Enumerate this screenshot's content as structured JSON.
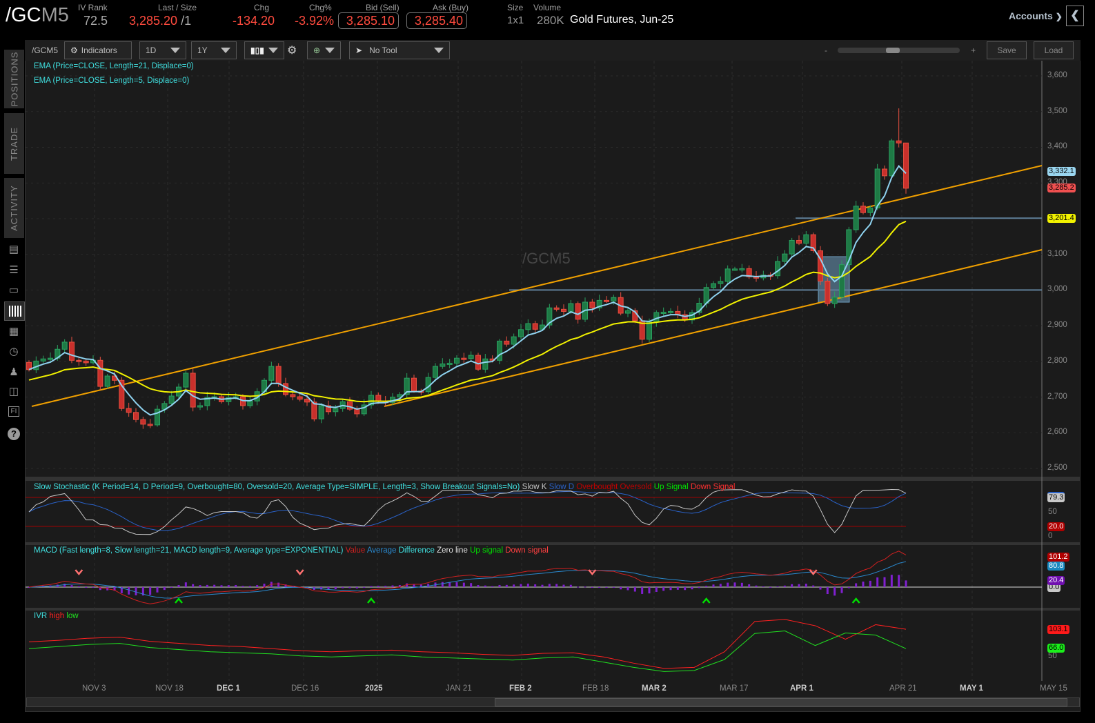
{
  "header": {
    "symbol_root": "/GC",
    "symbol_month": "M5",
    "iv_rank_label": "IV Rank",
    "iv_rank": "72.5",
    "last_label": "Last / Size",
    "last": "3,285.20",
    "size": "/1",
    "chg_label": "Chg",
    "chg": "-134.20",
    "chg_pct_label": "Chg%",
    "chg_pct": "-3.92%",
    "bid_label": "Bid (Sell)",
    "bid": "3,285.10",
    "ask_label": "Ask (Buy)",
    "ask": "3,285.40",
    "size_label": "Size",
    "size_value": "1x1",
    "volume_label": "Volume",
    "volume": "280K",
    "description": "Gold Futures, Jun-25",
    "accounts": "Accounts"
  },
  "sidebar": {
    "tabs": [
      "POSITIONS",
      "TRADE",
      "ACTIVITY"
    ],
    "icons": [
      "chart-report-icon",
      "list-icon",
      "tv-icon",
      "chart-icon",
      "grid-icon",
      "clock-icon",
      "people-icon",
      "calendar-icon",
      "fi-icon",
      "help-icon"
    ],
    "fi_label": "FI",
    "help_label": "?"
  },
  "toolbar": {
    "symbol": "/GCM5",
    "indicators": "Indicators",
    "aggregation": "1D",
    "range": "1Y",
    "drawing_tool": "No Tool",
    "zoom_minus": "-",
    "zoom_plus": "+",
    "save": "Save",
    "load": "Load"
  },
  "main_chart": {
    "watermark": "/GCM5",
    "studies": [
      "EMA (Price=CLOSE, Length=21, Displace=0)",
      "EMA (Price=CLOSE, Length=5, Displace=0)"
    ],
    "price_ticks": [
      "3,600",
      "3,500",
      "3,400",
      "3,300",
      "3,100",
      "3,000",
      "2,900",
      "2,800",
      "2,700",
      "2,600",
      "2,500"
    ],
    "tags": {
      "ema5": "3,332.1",
      "last": "3,285.2",
      "ema21": "3,201.4"
    },
    "colors": {
      "up": "#1e7a45",
      "down": "#c9302c",
      "ema5": "#8fd3f0",
      "ema21": "#f2f200",
      "trendline": "#f0a000",
      "level": "#5f7f99"
    }
  },
  "chart_data": {
    "type": "candlestick",
    "x_tick_labels": [
      "NOV 3",
      "NOV 18",
      "DEC 1",
      "DEC 16",
      "2025",
      "JAN 21",
      "FEB 2",
      "FEB 18",
      "MAR 2",
      "MAR 17",
      "APR 1",
      "APR 21",
      "MAY 1",
      "MAY 15"
    ],
    "ylim": [
      2500,
      3600
    ],
    "closes": [
      2777,
      2801,
      2807,
      2809,
      2834,
      2854,
      2803,
      2801,
      2796,
      2803,
      2730,
      2759,
      2747,
      2668,
      2657,
      2637,
      2624,
      2622,
      2666,
      2682,
      2703,
      2728,
      2767,
      2672,
      2676,
      2699,
      2701,
      2687,
      2699,
      2701,
      2676,
      2689,
      2715,
      2747,
      2786,
      2738,
      2707,
      2701,
      2694,
      2686,
      2639,
      2676,
      2659,
      2668,
      2687,
      2666,
      2653,
      2678,
      2705,
      2688,
      2685,
      2700,
      2707,
      2753,
      2717,
      2715,
      2755,
      2786,
      2793,
      2795,
      2809,
      2808,
      2817,
      2778,
      2807,
      2803,
      2857,
      2848,
      2869,
      2889,
      2906,
      2890,
      2902,
      2950,
      2946,
      2940,
      2962,
      2918,
      2966,
      2950,
      2971,
      2969,
      2979,
      2935,
      2942,
      2914,
      2862,
      2910,
      2937,
      2938,
      2940,
      2931,
      2916,
      2937,
      2963,
      3007,
      3018,
      3024,
      3059,
      3059,
      3060,
      3037,
      3034,
      3042,
      3040,
      3080,
      3101,
      3139,
      3131,
      3155,
      3110,
      3025,
      2962,
      2980,
      3071,
      3169,
      3235,
      3217,
      3230,
      3339,
      3320,
      3418,
      3412,
      3285.2
    ],
    "levels": [
      3000,
      3201.4
    ]
  },
  "stochastic": {
    "legend": "Slow Stochastic (K Period=14, D Period=9, Overbought=80, Oversold=20, Average Type=SIMPLE, Length=3, Show Breakout Signals=No)",
    "series": [
      {
        "name": "Slow K",
        "color": "#c8c8c8"
      },
      {
        "name": "Slow D",
        "color": "#2a62c9"
      },
      {
        "name": "Overbought",
        "color": "#c00000"
      },
      {
        "name": "Oversold",
        "color": "#c00000"
      },
      {
        "name": "Up Signal",
        "color": "#00e000"
      },
      {
        "name": "Down Signal",
        "color": "#ff3030"
      }
    ],
    "axis": {
      "k": "79.3",
      "mid": "50",
      "os": "20.0",
      "zero": "0"
    }
  },
  "macd": {
    "legend": "MACD (Fast length=8, Slow length=21, MACD length=9, Average type=EXPONENTIAL)",
    "series": [
      {
        "name": "Value",
        "color": "#d02020"
      },
      {
        "name": "Average",
        "color": "#2a8ad0"
      },
      {
        "name": "Difference",
        "color": "#40e0e0"
      },
      {
        "name": "Zero line",
        "color": "#e0e0e0"
      },
      {
        "name": "Up signal",
        "color": "#00e000"
      },
      {
        "name": "Down signal",
        "color": "#ff4040"
      }
    ],
    "axis": {
      "value": "101.2",
      "average": "80.8",
      "diff": "20.4",
      "zero": "0.0"
    },
    "signals": {
      "down": [
        7,
        38,
        79,
        110
      ],
      "up": [
        21,
        48,
        95,
        116
      ]
    }
  },
  "ivr": {
    "legend": "IVR",
    "series": [
      {
        "name": "high",
        "color": "#ff2020"
      },
      {
        "name": "low",
        "color": "#20e020"
      }
    ],
    "high": [
      79,
      82,
      86,
      88,
      80,
      76,
      72,
      70,
      66,
      62,
      60,
      62,
      63,
      60,
      58,
      55,
      53,
      57,
      58,
      50,
      38,
      28,
      30,
      60,
      118,
      122,
      110,
      84,
      112,
      103.1
    ],
    "low": [
      66,
      70,
      74,
      76,
      68,
      64,
      60,
      58,
      56,
      52,
      50,
      52,
      54,
      50,
      48,
      46,
      44,
      48,
      50,
      40,
      30,
      22,
      24,
      45,
      95,
      100,
      72,
      96,
      92,
      66.0
    ],
    "axis": {
      "high": "103.1",
      "low": "66.0",
      "mid": "50"
    }
  }
}
